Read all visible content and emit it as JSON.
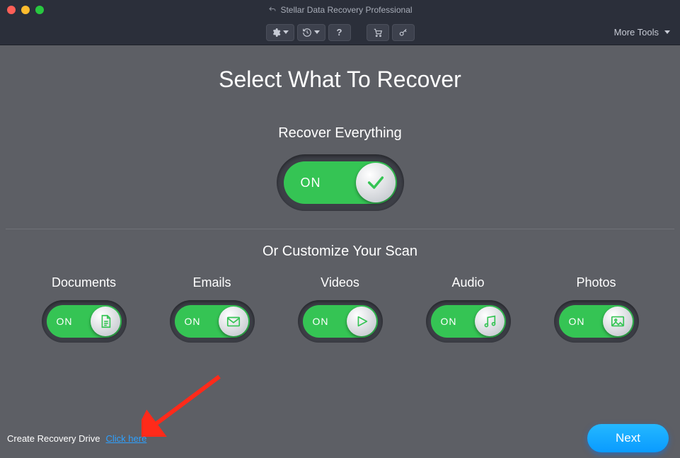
{
  "window": {
    "title": "Stellar Data Recovery Professional"
  },
  "toolbar": {
    "more_tools": "More Tools"
  },
  "main": {
    "headline": "Select What To Recover",
    "recover_everything_label": "Recover Everything",
    "customize_label": "Or Customize Your Scan",
    "toggle_on_text": "ON"
  },
  "categories": [
    {
      "key": "documents",
      "label": "Documents",
      "on_text": "ON",
      "icon": "document-icon"
    },
    {
      "key": "emails",
      "label": "Emails",
      "on_text": "ON",
      "icon": "envelope-icon"
    },
    {
      "key": "videos",
      "label": "Videos",
      "on_text": "ON",
      "icon": "play-icon"
    },
    {
      "key": "audio",
      "label": "Audio",
      "on_text": "ON",
      "icon": "music-icon"
    },
    {
      "key": "photos",
      "label": "Photos",
      "on_text": "ON",
      "icon": "image-icon"
    }
  ],
  "footer": {
    "create_drive_label": "Create Recovery Drive",
    "click_here": "Click here",
    "next_label": "Next"
  },
  "colors": {
    "accent_green": "#35c454",
    "accent_blue": "#0a9bff",
    "link_blue": "#2ea1ff"
  }
}
